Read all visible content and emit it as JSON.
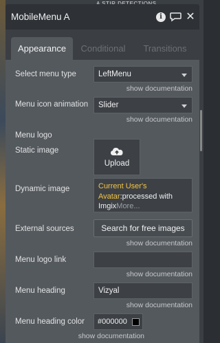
{
  "panel": {
    "title": "MobileMenu A",
    "background_text": "A STIR DETECTIONS"
  },
  "tabs": [
    {
      "label": "Appearance",
      "active": true
    },
    {
      "label": "Conditional",
      "active": false
    },
    {
      "label": "Transitions",
      "active": false
    }
  ],
  "rows": {
    "menu_type": {
      "label": "Select menu type",
      "value": "LeftMenu",
      "doc": "show documentation"
    },
    "icon_animation": {
      "label": "Menu icon animation",
      "value": "Slider",
      "doc": "show documentation"
    },
    "menu_logo": {
      "label": "Menu logo"
    },
    "static_image": {
      "label": "Static image",
      "upload_label": "Upload"
    },
    "dynamic_image": {
      "label": "Dynamic image",
      "expr_highlight": "Current User's Avatar",
      "expr_rest": ":processed with Imgix",
      "more": "More..."
    },
    "external_sources": {
      "label": "External sources",
      "button": "Search for free images",
      "doc": "show documentation"
    },
    "logo_link": {
      "label": "Menu logo link",
      "value": "",
      "doc": "show documentation"
    },
    "menu_heading": {
      "label": "Menu heading",
      "value": "Vizyal",
      "doc": "show documentation"
    },
    "heading_color": {
      "label": "Menu heading color",
      "value": "#000000",
      "swatch": "#000000",
      "doc": "show documentation"
    }
  }
}
